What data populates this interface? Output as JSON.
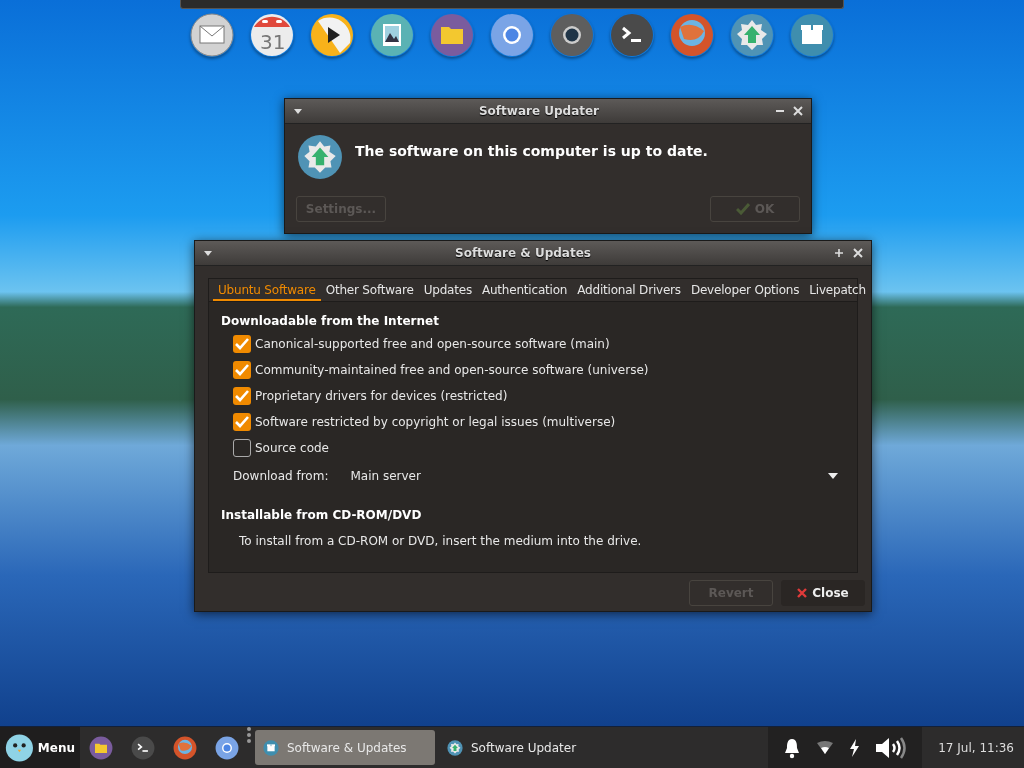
{
  "dock": {
    "items": [
      {
        "kind": "mail"
      },
      {
        "kind": "calendar",
        "text": "31"
      },
      {
        "kind": "player"
      },
      {
        "kind": "image"
      },
      {
        "kind": "folder"
      },
      {
        "kind": "browser"
      },
      {
        "kind": "camera"
      },
      {
        "kind": "terminal"
      },
      {
        "kind": "firefox"
      },
      {
        "kind": "updater"
      },
      {
        "kind": "package"
      }
    ]
  },
  "software_updater": {
    "title": "Software Updater",
    "message": "The software on this computer is up to date.",
    "buttons": [
      {
        "label": "Settings...",
        "kind": "plain",
        "disabled": true
      },
      {
        "label": "OK",
        "kind": "ok",
        "disabled": true
      }
    ]
  },
  "software_and_updates": {
    "title": "Software & Updates",
    "tabs": [
      {
        "label": "Ubuntu Software",
        "selected": true
      },
      {
        "label": "Other Software",
        "selected": false
      },
      {
        "label": "Updates",
        "selected": false
      },
      {
        "label": "Authentication",
        "selected": false
      },
      {
        "label": "Additional Drivers",
        "selected": false
      },
      {
        "label": "Developer Options",
        "selected": false
      },
      {
        "label": "Livepatch",
        "selected": false
      }
    ],
    "internet_heading": "Downloadable from the Internet",
    "sources": [
      {
        "label": "Canonical-supported free and open-source software (main)",
        "checked": true
      },
      {
        "label": "Community-maintained free and open-source software (universe)",
        "checked": true
      },
      {
        "label": "Proprietary drivers for devices (restricted)",
        "checked": true
      },
      {
        "label": "Software restricted by copyright or legal issues (multiverse)",
        "checked": true
      },
      {
        "label": "Source code",
        "checked": false
      }
    ],
    "download_from": {
      "label": "Download from:",
      "value": "Main server"
    },
    "cdrom_heading": "Installable from CD-ROM/DVD",
    "cdrom_text": "To install from a CD-ROM or DVD, insert the medium into the drive.",
    "buttons": [
      {
        "label": "Revert",
        "kind": "plain",
        "disabled": true
      },
      {
        "label": "Close",
        "kind": "close",
        "disabled": false
      }
    ]
  },
  "taskbar": {
    "menu_label": "Menu",
    "launchers": [
      {
        "kind": "folder"
      },
      {
        "kind": "terminal"
      },
      {
        "kind": "firefox"
      },
      {
        "kind": "browser"
      }
    ],
    "tasks": [
      {
        "label": "Software & Updates",
        "kind": "package",
        "selected": true
      },
      {
        "label": "Software Updater",
        "kind": "updater",
        "selected": false
      }
    ],
    "tray": [
      {
        "kind": "bell"
      },
      {
        "kind": "wifi"
      },
      {
        "kind": "power"
      },
      {
        "kind": "volume"
      }
    ],
    "clock": "17 Jul, 11:36"
  }
}
